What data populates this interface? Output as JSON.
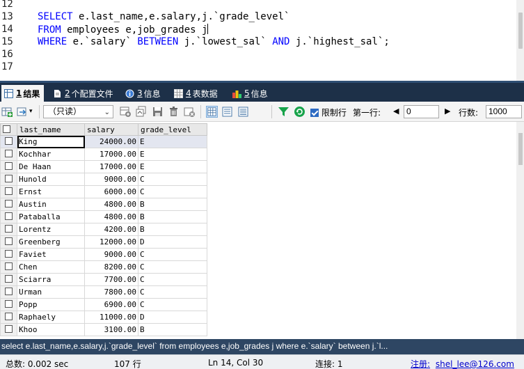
{
  "editor": {
    "line_numbers": [
      "12",
      "13",
      "14",
      "15",
      "16",
      "17"
    ],
    "lines": [
      [],
      [
        {
          "t": "SELECT",
          "k": true
        },
        {
          "t": " e.last_name,e.salary,j.`grade_level`",
          "k": false
        }
      ],
      [
        {
          "t": "FROM",
          "k": true
        },
        {
          "t": " employees e,job_grades j",
          "k": false
        }
      ],
      [
        {
          "t": "WHERE",
          "k": true
        },
        {
          "t": " e.`salary` ",
          "k": false
        },
        {
          "t": "BETWEEN",
          "k": true
        },
        {
          "t": " j.`lowest_sal` ",
          "k": false
        },
        {
          "t": "AND",
          "k": true
        },
        {
          "t": " j.`highest_sal`;",
          "k": false
        }
      ],
      [],
      []
    ]
  },
  "tabs": [
    {
      "num": "1",
      "label": "结果",
      "icon": "result-grid-icon",
      "active": true
    },
    {
      "num": "2",
      "label": "个配置文件",
      "icon": "profile-icon",
      "active": false
    },
    {
      "num": "3",
      "label": "信息",
      "icon": "info-icon",
      "active": false
    },
    {
      "num": "4",
      "label": "表数据",
      "icon": "table-data-icon",
      "active": false
    },
    {
      "num": "5",
      "label": "信息",
      "icon": "messages-icon",
      "active": false
    }
  ],
  "toolbar": {
    "mode_select": "（只读）",
    "limit_label": "限制行",
    "limit_checked": true,
    "first_row_label": "第一行:",
    "first_row_value": "0",
    "row_count_label": "行数:",
    "row_count_value": "1000"
  },
  "grid": {
    "columns": [
      "last_name",
      "salary",
      "grade_level"
    ],
    "rows": [
      [
        "King",
        "24000.00",
        "E"
      ],
      [
        "Kochhar",
        "17000.00",
        "E"
      ],
      [
        "De Haan",
        "17000.00",
        "E"
      ],
      [
        "Hunold",
        "9000.00",
        "C"
      ],
      [
        "Ernst",
        "6000.00",
        "C"
      ],
      [
        "Austin",
        "4800.00",
        "B"
      ],
      [
        "Pataballa",
        "4800.00",
        "B"
      ],
      [
        "Lorentz",
        "4200.00",
        "B"
      ],
      [
        "Greenberg",
        "12000.00",
        "D"
      ],
      [
        "Faviet",
        "9000.00",
        "C"
      ],
      [
        "Chen",
        "8200.00",
        "C"
      ],
      [
        "Sciarra",
        "7700.00",
        "C"
      ],
      [
        "Urman",
        "7800.00",
        "C"
      ],
      [
        "Popp",
        "6900.00",
        "C"
      ],
      [
        "Raphaely",
        "11000.00",
        "D"
      ],
      [
        "Khoo",
        "3100.00",
        "B"
      ]
    ]
  },
  "sql_bar": "select e.last_name,e.salary,j.`grade_level` from employees e,job_grades j where e.`salary` between j.`l...",
  "status": {
    "total_time": "总数: 0.002 sec",
    "row_count": "107 行",
    "cursor_pos": "Ln 14, Col 30",
    "connections": "连接: 1",
    "register_label": "注册:",
    "register_user": "shel_lee@126.com"
  },
  "colors": {
    "keyword": "#0000ff",
    "tab_bar": "#1d3048",
    "sql_bar": "#2e4663",
    "filter_green": "#17a34a"
  }
}
